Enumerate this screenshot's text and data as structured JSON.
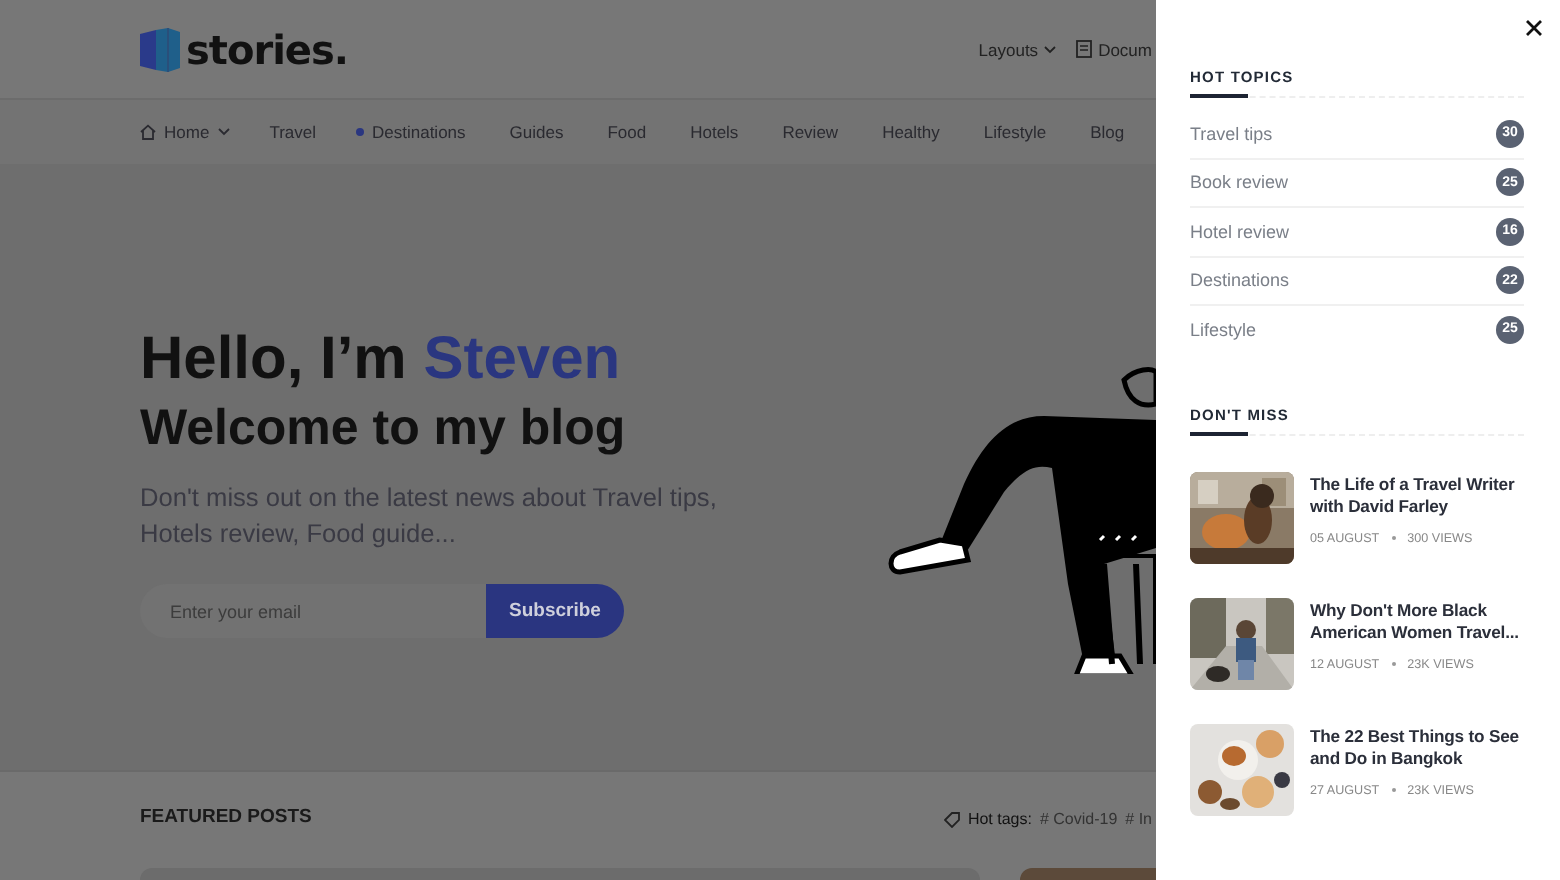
{
  "header": {
    "logo": "stories.",
    "menu": [
      {
        "label": "Layouts",
        "kind": "dropdown"
      },
      {
        "label": "Docum",
        "kind": "doc"
      }
    ]
  },
  "nav": [
    {
      "label": "Home",
      "kind": "home"
    },
    {
      "label": "Travel",
      "kind": "plain"
    },
    {
      "label": "Destinations",
      "kind": "dot"
    },
    {
      "label": "Guides",
      "kind": "plain"
    },
    {
      "label": "Food",
      "kind": "plain"
    },
    {
      "label": "Hotels",
      "kind": "plain"
    },
    {
      "label": "Review",
      "kind": "plain"
    },
    {
      "label": "Healthy",
      "kind": "plain"
    },
    {
      "label": "Lifestyle",
      "kind": "plain"
    },
    {
      "label": "Blog",
      "kind": "plain"
    }
  ],
  "hero": {
    "greeting": "Hello, I’m",
    "name": "Steven",
    "subtitle": "Welcome to my blog",
    "description": "Don't miss out on the latest news about Travel tips, Hotels review, Food guide...",
    "email": {
      "placeholder": "Enter your email"
    },
    "button": "Subscribe"
  },
  "featured": {
    "title": "FEATURED POSTS",
    "hot_tags_label": "Hot tags:",
    "tags": [
      "# Covid-19",
      "# In"
    ]
  },
  "panel": {
    "hot_topics": {
      "title": "HOT TOPICS",
      "items": [
        {
          "label": "Travel tips",
          "count": "30"
        },
        {
          "label": "Book review",
          "count": "25"
        },
        {
          "label": "Hotel review",
          "count": "16"
        },
        {
          "label": "Destinations",
          "count": "22"
        },
        {
          "label": "Lifestyle",
          "count": "25"
        }
      ]
    },
    "dont_miss": {
      "title": "DON'T MISS",
      "posts": [
        {
          "title": "The Life of a Travel Writer with David Farley",
          "date": "05 AUGUST",
          "views": "300 VIEWS"
        },
        {
          "title": "Why Don't More Black American Women Travel...",
          "date": "12 AUGUST",
          "views": "23K VIEWS"
        },
        {
          "title": "The 22 Best Things to See and Do in Bangkok",
          "date": "27 AUGUST",
          "views": "23K VIEWS"
        }
      ]
    }
  }
}
